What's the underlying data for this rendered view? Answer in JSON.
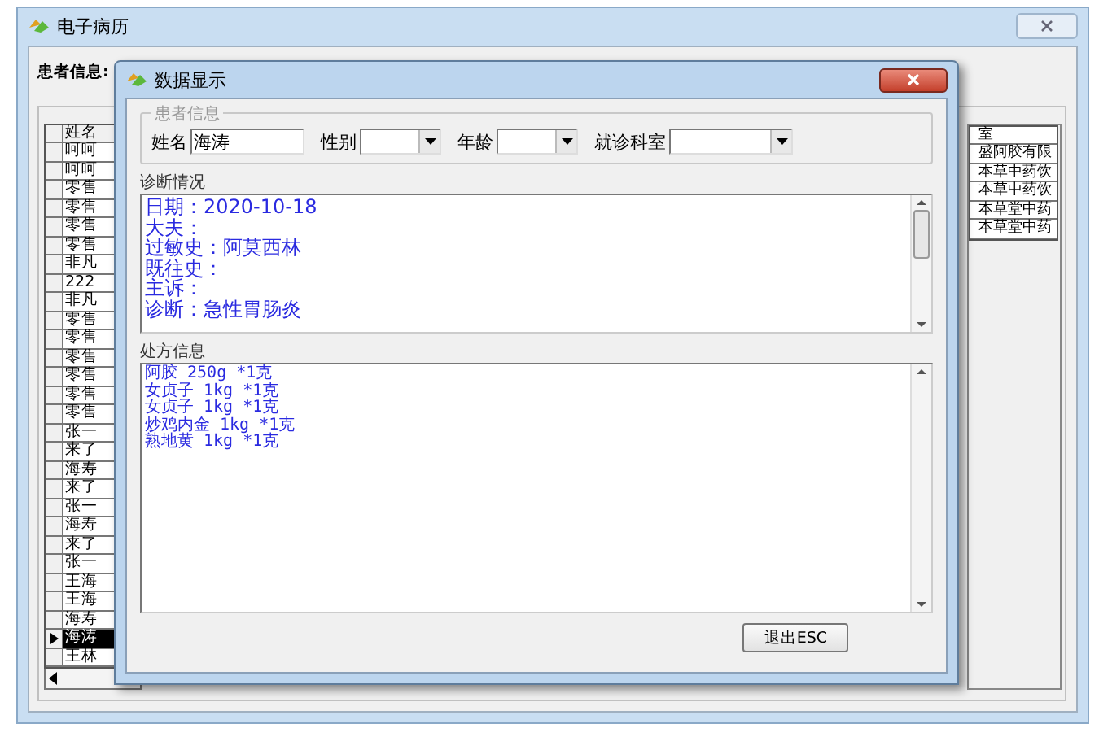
{
  "main_window": {
    "title": "电子病历",
    "patient_label": "患者信息:",
    "patient_grid": {
      "header": "姓名",
      "rows": [
        {
          "name": "呵呵",
          "selected": false
        },
        {
          "name": "呵呵",
          "selected": false
        },
        {
          "name": "零售",
          "selected": false
        },
        {
          "name": "零售",
          "selected": false
        },
        {
          "name": "零售",
          "selected": false
        },
        {
          "name": "零售",
          "selected": false
        },
        {
          "name": "非凡",
          "selected": false
        },
        {
          "name": "222",
          "selected": false
        },
        {
          "name": "非凡",
          "selected": false
        },
        {
          "name": "零售",
          "selected": false
        },
        {
          "name": "零售",
          "selected": false
        },
        {
          "name": "零售",
          "selected": false
        },
        {
          "name": "零售",
          "selected": false
        },
        {
          "name": "零售",
          "selected": false
        },
        {
          "name": "零售",
          "selected": false
        },
        {
          "name": "张一",
          "selected": false
        },
        {
          "name": "来了",
          "selected": false
        },
        {
          "name": "海寿",
          "selected": false
        },
        {
          "name": "来了",
          "selected": false
        },
        {
          "name": "张一",
          "selected": false
        },
        {
          "name": "海寿",
          "selected": false
        },
        {
          "name": "来了",
          "selected": false
        },
        {
          "name": "张一",
          "selected": false
        },
        {
          "name": "王海",
          "selected": false
        },
        {
          "name": "王海",
          "selected": false
        },
        {
          "name": "海寿",
          "selected": false
        },
        {
          "name": "海涛",
          "selected": true
        },
        {
          "name": "王林",
          "selected": false
        }
      ]
    },
    "right_grid": {
      "header": "室",
      "rows": [
        "盛阿胶有限",
        "本草中药饮",
        "本草中药饮",
        "本草堂中药",
        "本草堂中药"
      ]
    }
  },
  "dialog": {
    "title": "数据显示",
    "patient_group": {
      "title": "患者信息",
      "fields": [
        {
          "kind": "text",
          "label": "姓名",
          "value": "海涛"
        },
        {
          "kind": "dropdown",
          "label": "性别"
        },
        {
          "kind": "dropdown",
          "label": "年龄"
        },
        {
          "kind": "dropdown",
          "label": "就诊科室"
        }
      ]
    },
    "diagnosis": {
      "label": "诊断情况",
      "lines": [
        "日期：2020-10-18",
        "大夫：",
        "过敏史：阿莫西林",
        "既往史：",
        "主诉：",
        "诊断：急性胃肠炎"
      ]
    },
    "prescription": {
      "label": "处方信息",
      "lines": [
        "阿胶 250g *1克",
        "女贞子 1kg *1克",
        "女贞子 1kg *1克",
        "炒鸡内金 1kg *1克",
        "熟地黄 1kg *1克"
      ]
    },
    "exit_button": "退出ESC"
  }
}
